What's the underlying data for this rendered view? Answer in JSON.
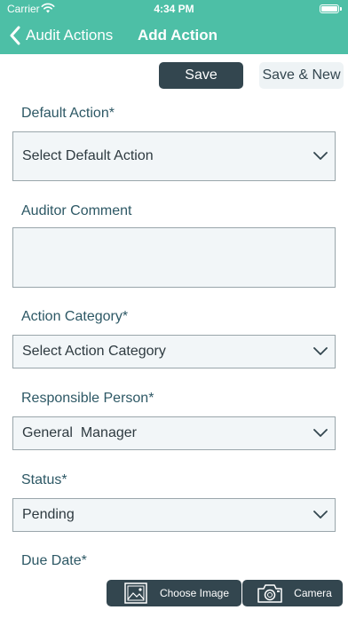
{
  "status_bar": {
    "carrier": "Carrier",
    "time": "4:34 PM"
  },
  "nav": {
    "back_label": "Audit Actions",
    "title": "Add Action"
  },
  "toolbar": {
    "save_label": "Save",
    "save_new_label": "Save & New"
  },
  "form": {
    "default_action": {
      "label": "Default Action*",
      "value": "Select Default Action"
    },
    "auditor_comment": {
      "label": "Auditor Comment",
      "value": ""
    },
    "action_category": {
      "label": "Action Category*",
      "value": "Select Action Category"
    },
    "responsible_person": {
      "label": "Responsible Person*",
      "value": "General  Manager"
    },
    "status": {
      "label": "Status*",
      "value": "Pending"
    },
    "due_date": {
      "label": "Due Date*"
    }
  },
  "bottom_actions": {
    "choose_image_label": "Choose Image",
    "camera_label": "Camera"
  },
  "colors": {
    "header": "#4dbfa6",
    "primary_button": "#33464f",
    "label_text": "#2d5865",
    "field_background": "#f2f6f8"
  },
  "icons": [
    "wifi-icon",
    "battery-icon",
    "back-chevron-icon",
    "chevron-down-icon",
    "image-icon",
    "camera-icon"
  ]
}
